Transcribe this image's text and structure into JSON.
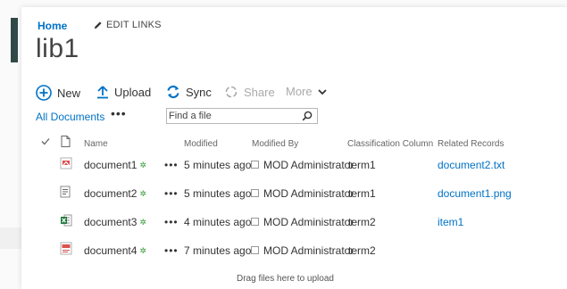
{
  "breadcrumb": {
    "home": "Home",
    "edit_links": "EDIT LINKS"
  },
  "page": {
    "title": "lib1"
  },
  "commands": {
    "new": "New",
    "upload": "Upload",
    "sync": "Sync",
    "share": "Share",
    "more": "More"
  },
  "view": {
    "current": "All Documents",
    "options": "•••"
  },
  "search": {
    "placeholder": "Find a file",
    "value": ""
  },
  "columns": {
    "name": "Name",
    "modified": "Modified",
    "modified_by": "Modified By",
    "classification": "Classification Column",
    "related": "Related Records"
  },
  "rows": [
    {
      "icon": "pdf-file-icon",
      "name": "document1",
      "modified": "5 minutes ago",
      "modified_by": "MOD Administrator",
      "classification": "term1",
      "related": "document2.txt"
    },
    {
      "icon": "text-file-icon",
      "name": "document2",
      "modified": "5 minutes ago",
      "modified_by": "MOD Administrator",
      "classification": "term1",
      "related": "document1.png"
    },
    {
      "icon": "excel-file-icon",
      "name": "document3",
      "modified": "4 minutes ago",
      "modified_by": "MOD Administrator",
      "classification": "term2",
      "related": "item1"
    },
    {
      "icon": "image-file-icon",
      "name": "document4",
      "modified": "7 minutes ago",
      "modified_by": "MOD Administrator",
      "classification": "term2",
      "related": ""
    }
  ],
  "row_ellipsis": "•••",
  "drop_zone": "Drag files here to upload",
  "colors": {
    "accent": "#0072c6",
    "sidebar": "#2f4a46",
    "new_star": "#3a9a3a"
  }
}
